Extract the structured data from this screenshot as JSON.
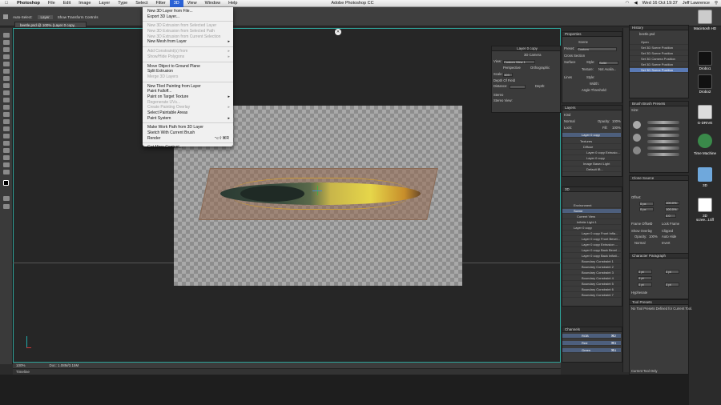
{
  "menubar": {
    "apple": "",
    "app": "Photoshop",
    "items": [
      "File",
      "Edit",
      "Image",
      "Layer",
      "Type",
      "Select",
      "Filter",
      "3D",
      "View",
      "Window",
      "Help"
    ],
    "active": "3D",
    "title": "Adobe Photoshop CC",
    "clock": "Wed 16 Oct 19:37",
    "user": "Jeff Lawrence"
  },
  "options": {
    "autoselect": "Auto-Select:",
    "layer": "Layer",
    "transform": "Show Transform Controls"
  },
  "document": {
    "tab": "beetle.psd @ 100% (Layer 0 copy, RGB/8)",
    "zoom": "100%",
    "doc_size": "Doc: 1.08M/3.15M"
  },
  "timeline": {
    "label": "Timeline"
  },
  "dropdown": {
    "items": [
      {
        "label": "New 3D Layer from File...",
        "disabled": false
      },
      {
        "label": "Export 3D Layer...",
        "disabled": false
      },
      {
        "sep": true
      },
      {
        "label": "New 3D Extrusion from Selected Layer",
        "disabled": true
      },
      {
        "label": "New 3D Extrusion from Selected Path",
        "disabled": true
      },
      {
        "label": "New 3D Extrusion from Current Selection",
        "disabled": true
      },
      {
        "label": "New Mesh from Layer",
        "disabled": false,
        "sub": true
      },
      {
        "sep": true
      },
      {
        "label": "Add Constraint(s) from",
        "disabled": true,
        "sub": true
      },
      {
        "label": "Show/Hide Polygons",
        "disabled": true,
        "sub": true
      },
      {
        "sep": true
      },
      {
        "label": "Move Object to Ground Plane",
        "disabled": false
      },
      {
        "label": "Split Extrusion",
        "disabled": false
      },
      {
        "label": "Merge 3D Layers",
        "disabled": true
      },
      {
        "sep": true
      },
      {
        "label": "New Tiled Painting from Layer",
        "disabled": false
      },
      {
        "label": "Paint Falloff...",
        "disabled": false
      },
      {
        "label": "Paint on Target Texture",
        "disabled": false,
        "sub": true
      },
      {
        "label": "Regenerate UVs...",
        "disabled": true
      },
      {
        "label": "Create Painting Overlay",
        "disabled": true,
        "sub": true
      },
      {
        "label": "Select Paintable Areas",
        "disabled": false
      },
      {
        "label": "Paint System",
        "disabled": false,
        "sub": true
      },
      {
        "sep": true
      },
      {
        "label": "Make Work Path from 3D Layer",
        "disabled": false
      },
      {
        "label": "Sketch With Current Brush",
        "disabled": false
      },
      {
        "label": "Render",
        "disabled": false,
        "shortcut": "⌥⇧⌘R"
      },
      {
        "sep": true
      },
      {
        "label": "Get More Content...",
        "disabled": false
      }
    ]
  },
  "float_panel": {
    "title": "Layer 0 copy",
    "camera": "3D Camera",
    "view_label": "View:",
    "view_value": "Custom View 1",
    "perspective": "Perspective",
    "orthographic": "Orthographic",
    "scale_label": "Scale:",
    "scale_value": "103",
    "depth_of_field": "Depth Of Field",
    "distance": "Distance:",
    "depth": "Depth:",
    "stereo": "Stereo",
    "stereo_view": "Stereo View:"
  },
  "properties": {
    "title": "Properties",
    "scene": "Scene",
    "preset": "Preset:",
    "preset_value": "Custom",
    "cross_section": "Cross Section",
    "surface": "Surface",
    "style": "Style:",
    "style_value": "Solid",
    "texture": "Texture:",
    "texture_value": "Not Availa...",
    "lines": "Lines",
    "style2": "Style:",
    "width": "Width:",
    "angle": "Angle Threshold:"
  },
  "history": {
    "title": "History",
    "file": "beetle.psd",
    "items": [
      "Open",
      "Set 3D Scene Position",
      "Set 3D Scene Position",
      "Set 3D Camera Position",
      "Set 3D Scene Position",
      "Set 3D Scene Position"
    ]
  },
  "layers": {
    "title": "Layers",
    "kind": "Kind",
    "normal": "Normal",
    "opacity": "Opacity:",
    "opacity_value": "100%",
    "lock": "Lock:",
    "fill": "Fill:",
    "fill_value": "100%",
    "items": [
      "Layer 0 copy",
      "Textures",
      "Diffuse",
      "Layer 0 copy Extrusio...",
      "Layer 0 copy",
      "Image Based Light",
      "Default IB..."
    ]
  },
  "brush": {
    "tab1": "Brush",
    "tab2": "Brush Presets",
    "size": "Size:"
  },
  "scene3d": {
    "title": "3D",
    "items": [
      "Environment",
      "Scene",
      "Current View",
      "Infinite Light 1",
      "Layer 0 copy",
      "Layer 0 copy Front Infla...",
      "Layer 0 copy Front Bevel...",
      "Layer 0 copy Extrusion ...",
      "Layer 0 copy Back Bevel ...",
      "Layer 0 copy Back Inflati...",
      "Boundary Constraint 1",
      "Boundary Constraint 2",
      "Boundary Constraint 3",
      "Boundary Constraint 4",
      "Boundary Constraint 5",
      "Boundary Constraint 6",
      "Boundary Constraint 7"
    ]
  },
  "clone": {
    "title": "Clone Source",
    "offset": "Offset:",
    "x": "0 px",
    "y": "0 px",
    "w": "100.0%",
    "h": "100.0%",
    "angle": "0.0",
    "frame_offset": "Frame Offset:",
    "frame_value": "0",
    "lock_frame": "Lock Frame",
    "show_overlay": "Show Overlay",
    "clipped": "Clipped",
    "opacity": "Opacity:",
    "opacity_value": "100%",
    "auto_hide": "Auto Hide",
    "normal": "Normal",
    "invert": "Invert"
  },
  "character": {
    "tab1": "Character",
    "tab2": "Paragraph",
    "v0": "0 pt",
    "v1": "0 pt",
    "v2": "0 pt",
    "v3": "0 pt",
    "v4": "0 pt",
    "hyphenate": "Hyphenate"
  },
  "tool_presets": {
    "title": "Tool Presets",
    "msg": "No Tool Presets Defined for Current Tool.",
    "current": "Current Tool Only"
  },
  "channels": {
    "title": "Channels",
    "items": [
      {
        "name": "RGB",
        "key": "⌘2"
      },
      {
        "name": "Red",
        "key": "⌘3"
      },
      {
        "name": "Green",
        "key": "⌘4"
      }
    ]
  },
  "desktop": {
    "icons": [
      "Macintosh HD",
      "Drobo1",
      "Drobo2",
      "G-DRIVE",
      "Time Machine",
      "3D",
      "3D\nscree...t.tiff"
    ]
  },
  "colors": {
    "accent": "#2a62d6",
    "canvas_border": "#2fa39a"
  }
}
